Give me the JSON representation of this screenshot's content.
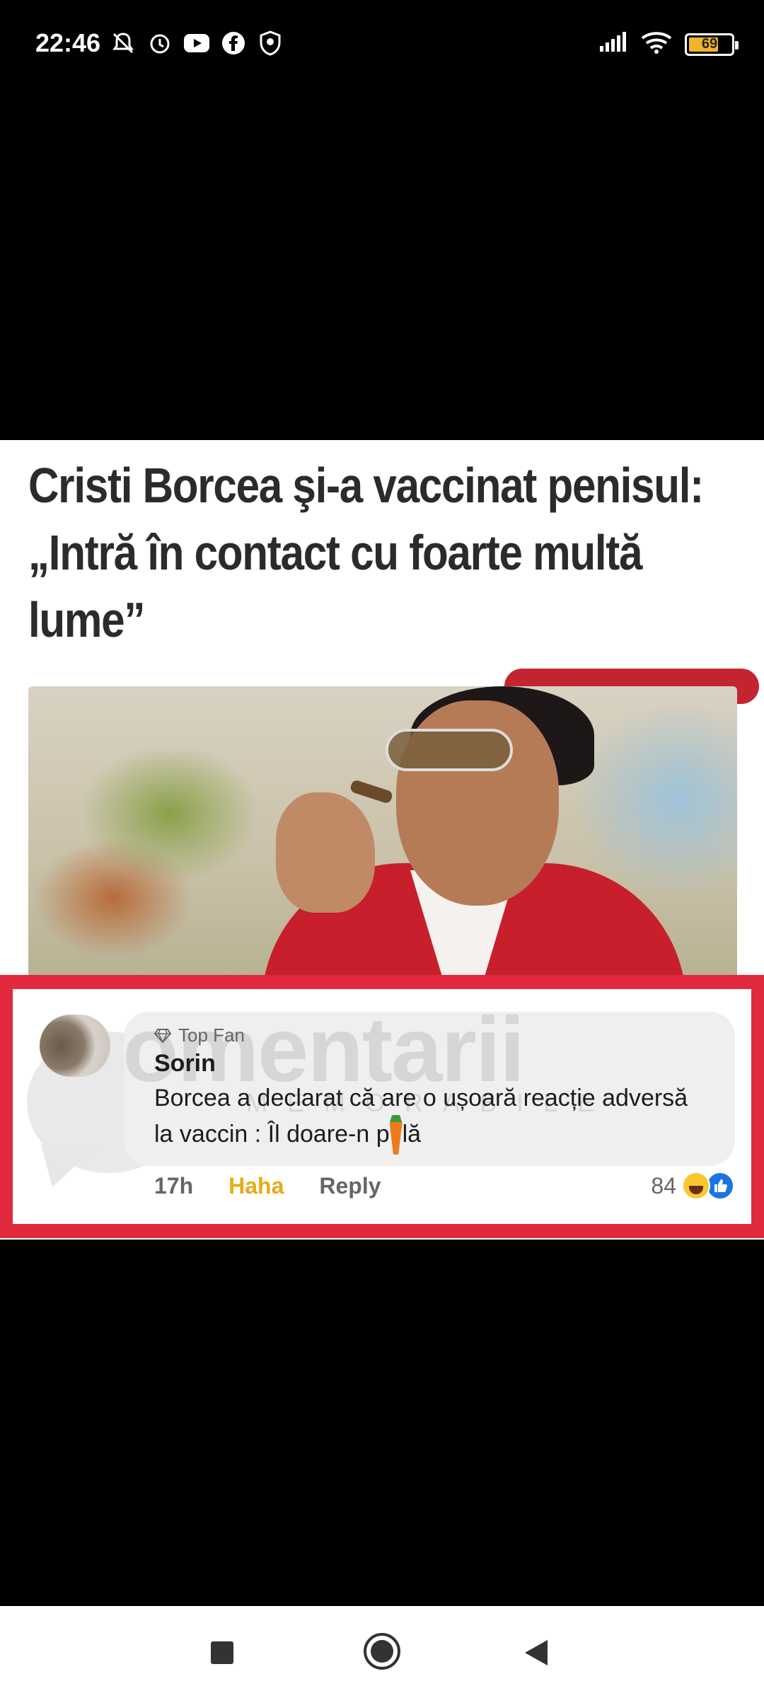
{
  "status_bar": {
    "time": "22:46",
    "battery": "69",
    "battery_level_percent": 69,
    "icons_left": [
      "mute-icon",
      "alarm-icon",
      "youtube-icon",
      "facebook-icon",
      "shield-icon"
    ],
    "icons_right": [
      "signal-icon",
      "wifi-icon",
      "battery-icon"
    ]
  },
  "article": {
    "headline": "Cristi Borcea şi-a vaccinat penisul: „Intră în contact cu foarte multă lume”"
  },
  "comment": {
    "badge": "Top Fan",
    "author": "Sorin",
    "text_before": "Borcea a declarat că are o ușoară reacție adversă la vaccin : Îl doare-n p",
    "text_after": "lă",
    "time": "17h",
    "reaction_label": "Haha",
    "reply_label": "Reply",
    "reaction_count": "84",
    "reaction_icons": [
      "haha-emoji-icon",
      "like-icon"
    ]
  },
  "watermark": {
    "text": "omentarii",
    "sub": "MEMORABILE"
  },
  "nav": {
    "buttons": [
      "recents-button",
      "home-button",
      "back-button"
    ]
  },
  "colors": {
    "frame": "#e1293d",
    "haha": "#e8ab16",
    "like": "#1b74e4",
    "battery_fill": "#f0b429"
  }
}
